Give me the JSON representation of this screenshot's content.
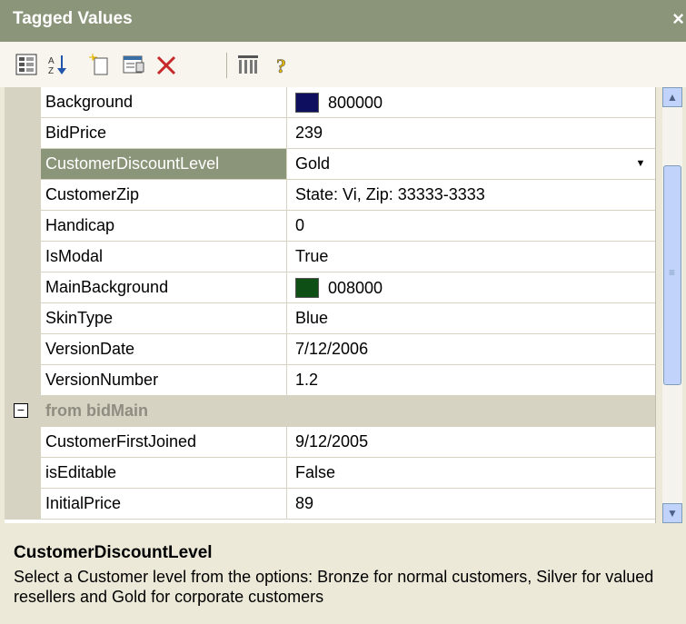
{
  "window": {
    "title": "Tagged Values",
    "close_label": "×"
  },
  "toolbar": {
    "icons": [
      "categorized-icon",
      "alphabetical-sort-icon",
      "new-tag-icon",
      "properties-icon",
      "delete-icon",
      "columns-icon",
      "help-icon"
    ]
  },
  "rows": [
    {
      "name": "Background",
      "value": "800000",
      "swatch": "#0f0f5f"
    },
    {
      "name": "BidPrice",
      "value": "239"
    },
    {
      "name": "CustomerDiscountLevel",
      "value": "Gold",
      "selected": true,
      "dropdown": "▼"
    },
    {
      "name": "CustomerZip",
      "value": "State: Vi, Zip: 33333-3333"
    },
    {
      "name": "Handicap",
      "value": "0"
    },
    {
      "name": "IsModal",
      "value": "True"
    },
    {
      "name": "MainBackground",
      "value": "008000",
      "swatch": "#0d4f14"
    },
    {
      "name": "SkinType",
      "value": "Blue"
    },
    {
      "name": "VersionDate",
      "value": "7/12/2006"
    },
    {
      "name": "VersionNumber",
      "value": "1.2"
    }
  ],
  "category": {
    "label": "from bidMain",
    "toggle": "−"
  },
  "category_rows": [
    {
      "name": "CustomerFirstJoined",
      "value": "9/12/2005"
    },
    {
      "name": "isEditable",
      "value": "False"
    },
    {
      "name": "InitialPrice",
      "value": "89"
    }
  ],
  "scrollbar": {
    "up": "▲",
    "down": "▼",
    "grip": "≡"
  },
  "description": {
    "title": "CustomerDiscountLevel",
    "text": "Select a Customer level from the options: Bronze for normal customers, Silver for valued resellers and Gold for corporate customers"
  },
  "colors": {
    "titlebar": "#8b957a",
    "selection": "#8b957a",
    "gutter": "#d6d3c2"
  }
}
